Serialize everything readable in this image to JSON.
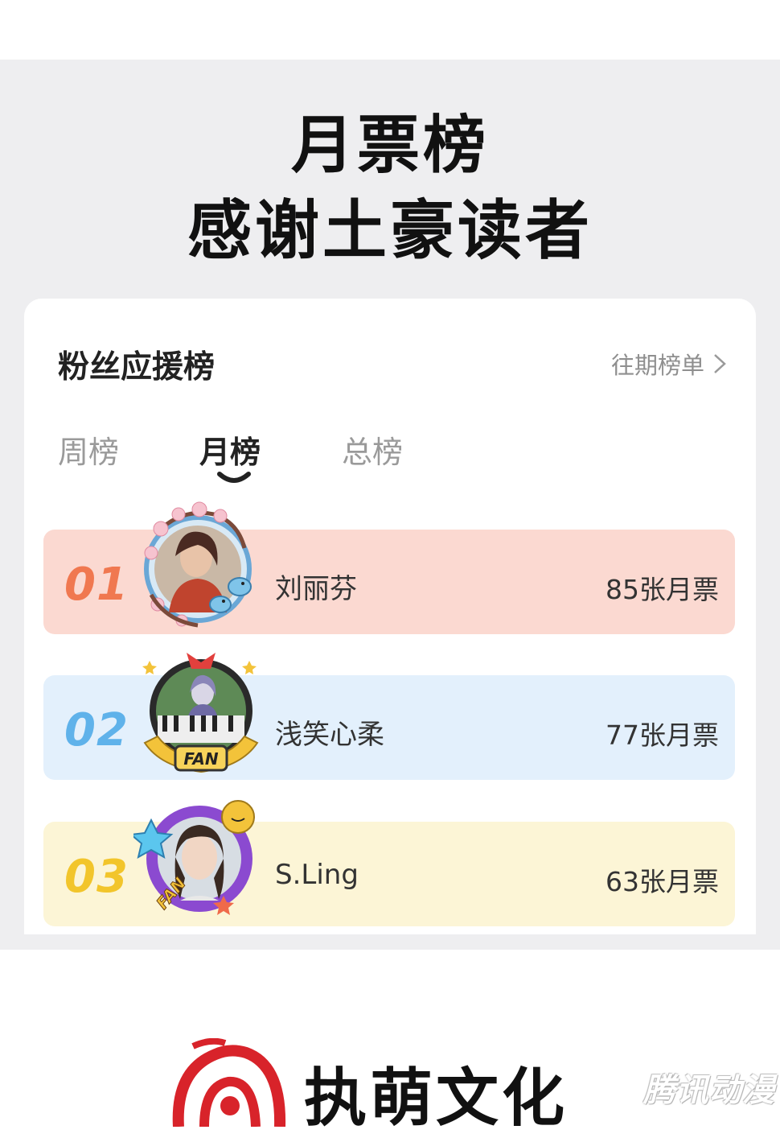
{
  "headline": {
    "line1": "月票榜",
    "line2": "感谢土豪读者"
  },
  "card": {
    "title": "粉丝应援榜",
    "history_link": "往期榜单"
  },
  "tabs": [
    {
      "label": "周榜",
      "active": false
    },
    {
      "label": "月榜",
      "active": true
    },
    {
      "label": "总榜",
      "active": false
    }
  ],
  "ranking": [
    {
      "rank": "01",
      "name": "刘丽芬",
      "tickets": "85张月票",
      "color": "#f07850",
      "row_bg": "#fbd9d1"
    },
    {
      "rank": "02",
      "name": "浅笑心柔",
      "tickets": "77张月票",
      "color": "#5fb2ea",
      "row_bg": "#e3f0fc"
    },
    {
      "rank": "03",
      "name": "S.Ling",
      "tickets": "63张月票",
      "color": "#f2c52b",
      "row_bg": "#fcf5d6"
    }
  ],
  "footer": {
    "brand": "执萌文化",
    "watermark": "腾讯动漫",
    "brand_color": "#d8232a"
  }
}
